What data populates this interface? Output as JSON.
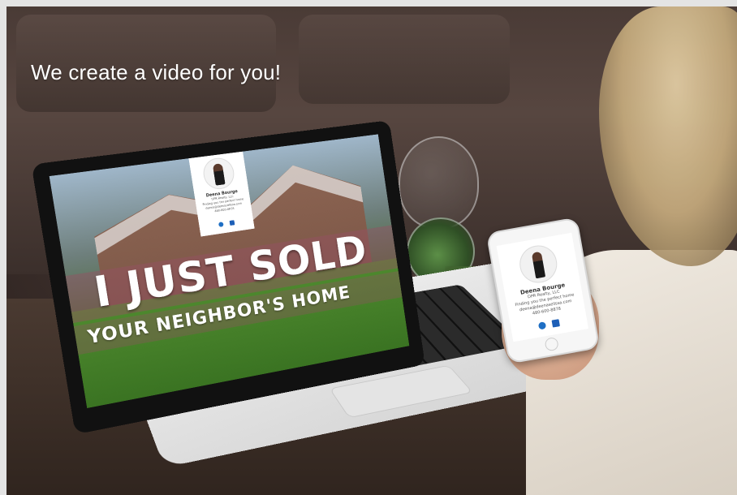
{
  "headline": "We create a video for you!",
  "video": {
    "line1": "I JUST SOLD",
    "line2": "YOUR NEIGHBOR'S HOME"
  },
  "agent": {
    "name": "Deena Bourge",
    "company": "DPR Realty, LLC",
    "tagline": "Finding you the perfect home",
    "email": "deena@deenasellssa.com",
    "phone": "480-600-8878"
  },
  "icons": {
    "website": "globe-icon",
    "social": "facebook-icon"
  },
  "colors": {
    "icon_blue": "#1d5fb7",
    "lawn_green": "#3f7a25",
    "banner_mauve": "#965064"
  }
}
